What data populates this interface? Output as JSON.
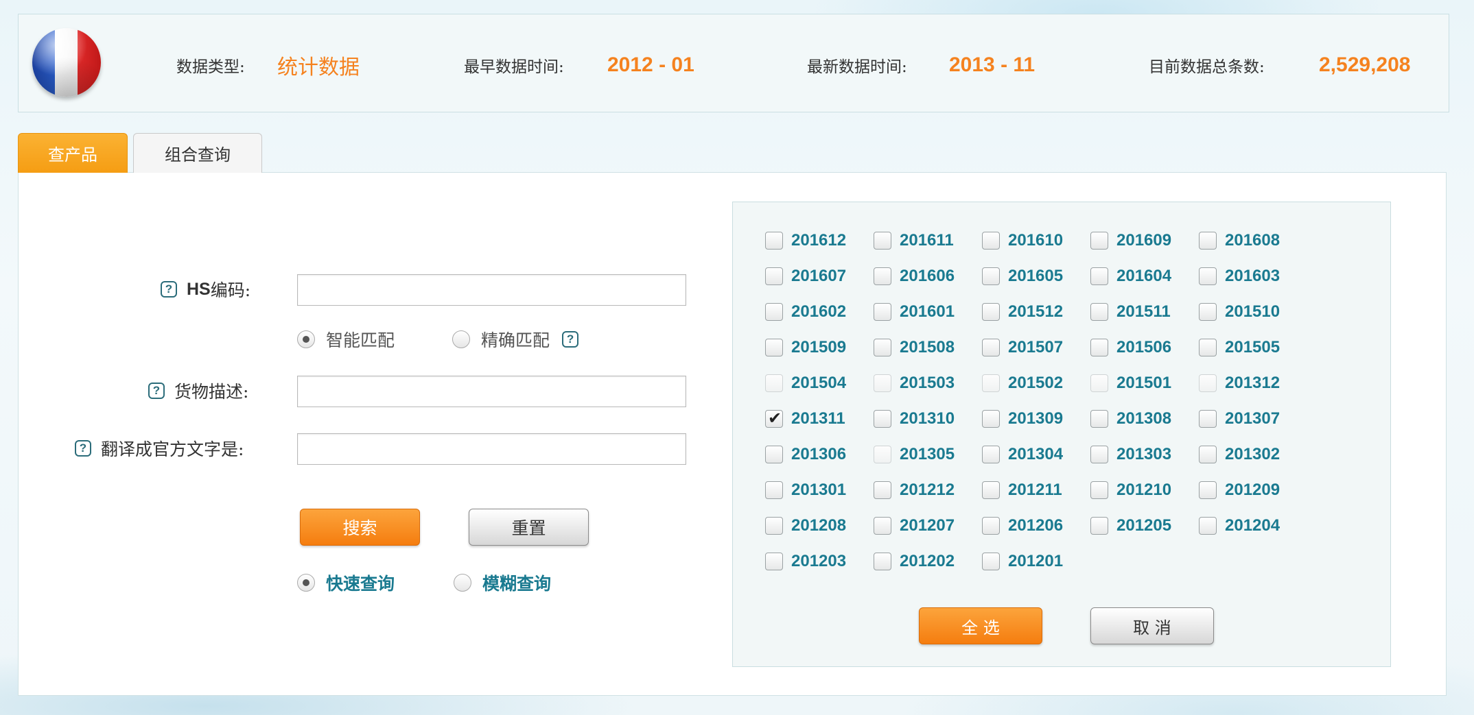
{
  "info_bar": {
    "data_type_label": "数据类型:",
    "data_type_value": "统计数据",
    "earliest_label": "最早数据时间:",
    "earliest_value": "2012 - 01",
    "latest_label": "最新数据时间:",
    "latest_value": "2013 - 11",
    "total_label": "目前数据总条数:",
    "total_value": "2,529,208"
  },
  "tabs": [
    {
      "label": "查产品",
      "active": true
    },
    {
      "label": "组合查询",
      "active": false
    }
  ],
  "form": {
    "hs_label_prefix": "HS",
    "hs_label_suffix": "编码:",
    "hs_value": "",
    "match_options": [
      {
        "label": "智能匹配",
        "selected": true
      },
      {
        "label": "精确匹配",
        "selected": false
      }
    ],
    "desc_label": "货物描述:",
    "desc_value": "",
    "translate_label": "翻译成官方文字是:",
    "translate_value": "",
    "help_glyph": "?",
    "search_label": "搜索",
    "reset_label": "重置",
    "query_options": [
      {
        "label": "快速查询",
        "selected": true
      },
      {
        "label": "模糊查询",
        "selected": false
      }
    ]
  },
  "months": {
    "items": [
      {
        "label": "201612",
        "checked": false,
        "faded": false
      },
      {
        "label": "201611",
        "checked": false,
        "faded": false
      },
      {
        "label": "201610",
        "checked": false,
        "faded": false
      },
      {
        "label": "201609",
        "checked": false,
        "faded": false
      },
      {
        "label": "201608",
        "checked": false,
        "faded": false
      },
      {
        "label": "201607",
        "checked": false,
        "faded": false
      },
      {
        "label": "201606",
        "checked": false,
        "faded": false
      },
      {
        "label": "201605",
        "checked": false,
        "faded": false
      },
      {
        "label": "201604",
        "checked": false,
        "faded": false
      },
      {
        "label": "201603",
        "checked": false,
        "faded": false
      },
      {
        "label": "201602",
        "checked": false,
        "faded": false
      },
      {
        "label": "201601",
        "checked": false,
        "faded": false
      },
      {
        "label": "201512",
        "checked": false,
        "faded": false
      },
      {
        "label": "201511",
        "checked": false,
        "faded": false
      },
      {
        "label": "201510",
        "checked": false,
        "faded": false
      },
      {
        "label": "201509",
        "checked": false,
        "faded": false
      },
      {
        "label": "201508",
        "checked": false,
        "faded": false
      },
      {
        "label": "201507",
        "checked": false,
        "faded": false
      },
      {
        "label": "201506",
        "checked": false,
        "faded": false
      },
      {
        "label": "201505",
        "checked": false,
        "faded": false
      },
      {
        "label": "201504",
        "checked": false,
        "faded": true
      },
      {
        "label": "201503",
        "checked": false,
        "faded": true
      },
      {
        "label": "201502",
        "checked": false,
        "faded": true
      },
      {
        "label": "201501",
        "checked": false,
        "faded": true
      },
      {
        "label": "201312",
        "checked": false,
        "faded": true
      },
      {
        "label": "201311",
        "checked": true,
        "faded": false
      },
      {
        "label": "201310",
        "checked": false,
        "faded": false
      },
      {
        "label": "201309",
        "checked": false,
        "faded": false
      },
      {
        "label": "201308",
        "checked": false,
        "faded": false
      },
      {
        "label": "201307",
        "checked": false,
        "faded": false
      },
      {
        "label": "201306",
        "checked": false,
        "faded": false
      },
      {
        "label": "201305",
        "checked": false,
        "faded": true
      },
      {
        "label": "201304",
        "checked": false,
        "faded": false
      },
      {
        "label": "201303",
        "checked": false,
        "faded": false
      },
      {
        "label": "201302",
        "checked": false,
        "faded": false
      },
      {
        "label": "201301",
        "checked": false,
        "faded": false
      },
      {
        "label": "201212",
        "checked": false,
        "faded": false
      },
      {
        "label": "201211",
        "checked": false,
        "faded": false
      },
      {
        "label": "201210",
        "checked": false,
        "faded": false
      },
      {
        "label": "201209",
        "checked": false,
        "faded": false
      },
      {
        "label": "201208",
        "checked": false,
        "faded": false
      },
      {
        "label": "201207",
        "checked": false,
        "faded": false
      },
      {
        "label": "201206",
        "checked": false,
        "faded": false
      },
      {
        "label": "201205",
        "checked": false,
        "faded": false
      },
      {
        "label": "201204",
        "checked": false,
        "faded": false
      },
      {
        "label": "201203",
        "checked": false,
        "faded": false
      },
      {
        "label": "201202",
        "checked": false,
        "faded": false
      },
      {
        "label": "201201",
        "checked": false,
        "faded": false
      }
    ],
    "select_all_label": "全 选",
    "cancel_label": "取 消"
  }
}
